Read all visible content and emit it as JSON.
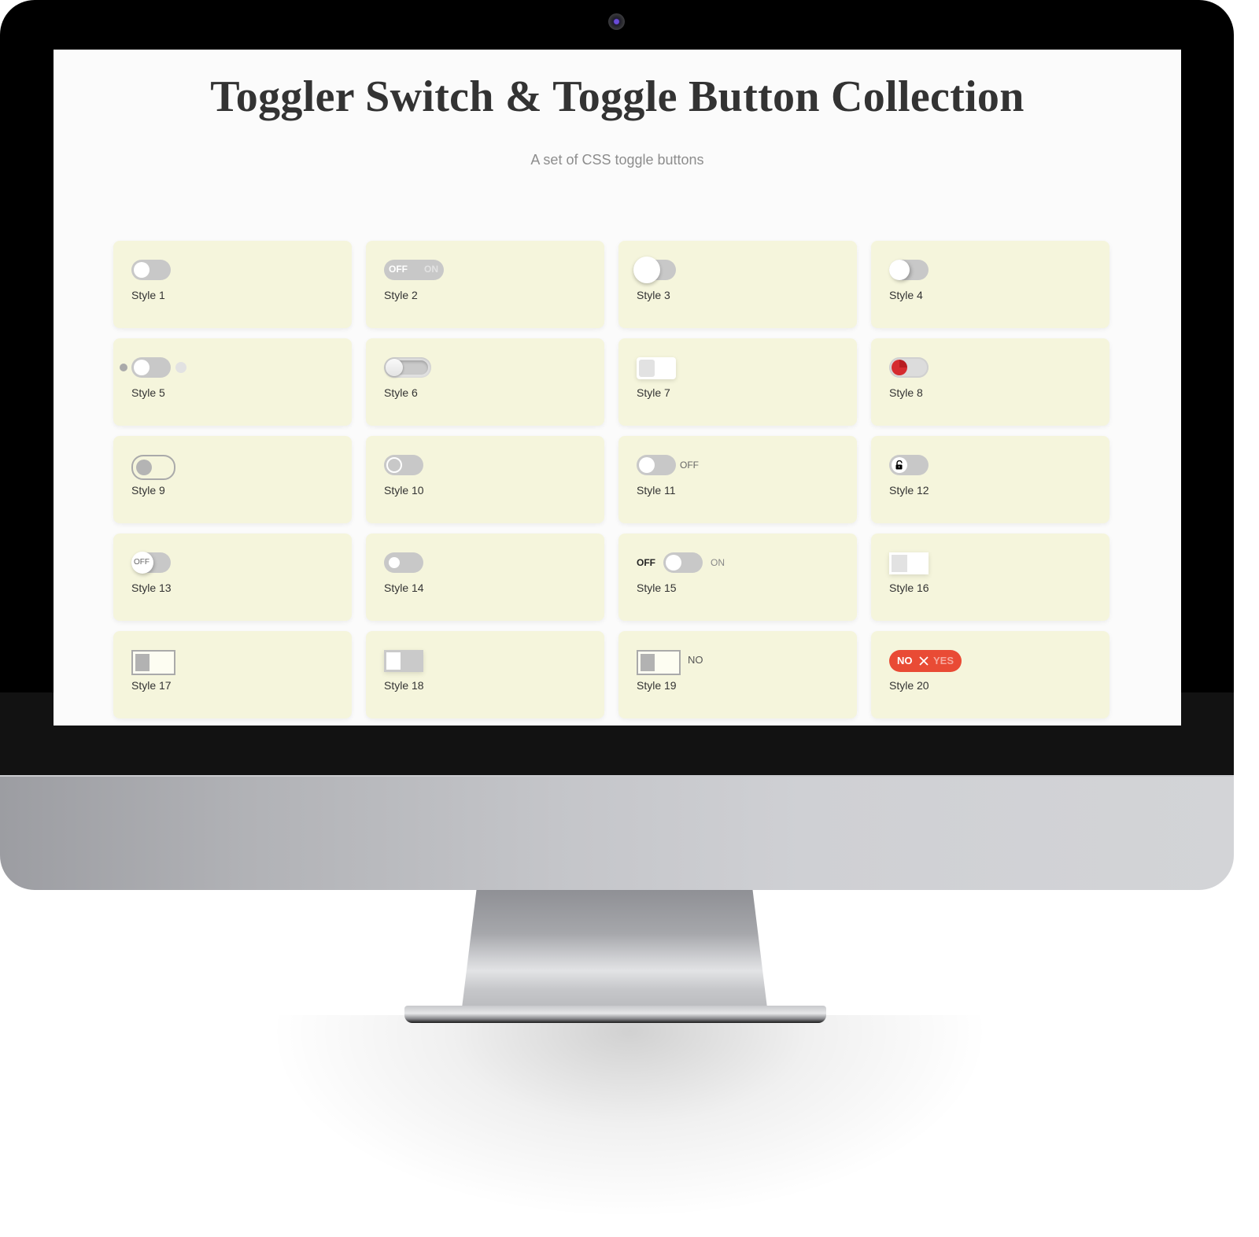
{
  "page": {
    "title": "Toggler Switch & Toggle Button Collection",
    "subtitle": "A set of CSS toggle buttons"
  },
  "colors": {
    "card_bg": "#f5f5dc",
    "track_gray": "#c8c8c8",
    "accent_red": "#e94b35",
    "knob_red": "#c9262a"
  },
  "toggles": [
    {
      "label": "Style 1",
      "state": "off"
    },
    {
      "label": "Style 2",
      "state": "off",
      "off_text": "OFF",
      "on_text": "ON"
    },
    {
      "label": "Style 3",
      "state": "off"
    },
    {
      "label": "Style 4",
      "state": "off"
    },
    {
      "label": "Style 5",
      "state": "off"
    },
    {
      "label": "Style 6",
      "state": "off"
    },
    {
      "label": "Style 7",
      "state": "off"
    },
    {
      "label": "Style 8",
      "state": "off"
    },
    {
      "label": "Style 9",
      "state": "off"
    },
    {
      "label": "Style 10",
      "state": "off"
    },
    {
      "label": "Style 11",
      "state": "off",
      "state_text": "OFF"
    },
    {
      "label": "Style 12",
      "state": "off",
      "icon": "unlock-icon"
    },
    {
      "label": "Style 13",
      "state": "off",
      "knob_text": "OFF"
    },
    {
      "label": "Style 14",
      "state": "off"
    },
    {
      "label": "Style 15",
      "state": "off",
      "off_text": "OFF",
      "on_text": "ON"
    },
    {
      "label": "Style 16",
      "state": "off"
    },
    {
      "label": "Style 17",
      "state": "off"
    },
    {
      "label": "Style 18",
      "state": "off"
    },
    {
      "label": "Style 19",
      "state": "off",
      "state_text": "NO"
    },
    {
      "label": "Style 20",
      "state": "off",
      "off_text": "NO",
      "on_text": "YES",
      "icon": "x-icon"
    }
  ]
}
